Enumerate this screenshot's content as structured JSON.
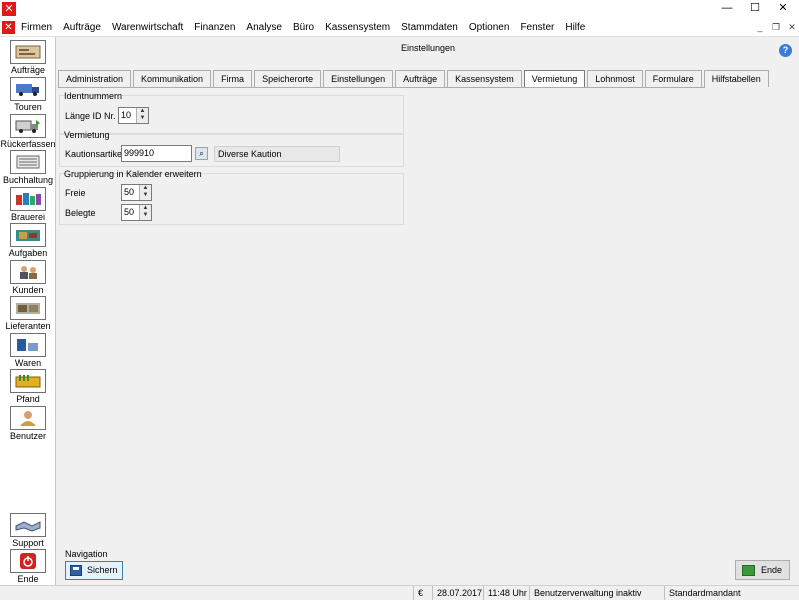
{
  "window": {
    "minimize": "—",
    "maximize": "☐",
    "close": "✕"
  },
  "menu": {
    "items": [
      "Firmen",
      "Aufträge",
      "Warenwirtschaft",
      "Finanzen",
      "Analyse",
      "Büro",
      "Kassensystem",
      "Stammdaten",
      "Optionen",
      "Fenster",
      "Hilfe"
    ],
    "mdi": {
      "minimize": "_",
      "restore": "❐",
      "close": "✕"
    }
  },
  "sidebar": {
    "items": [
      {
        "label": "Aufträge",
        "icon": "orders-icon"
      },
      {
        "label": "Touren",
        "icon": "truck-icon"
      },
      {
        "label": "Rückerfassen",
        "icon": "return-truck-icon"
      },
      {
        "label": "Buchhaltung",
        "icon": "ledger-icon"
      },
      {
        "label": "Brauerei",
        "icon": "brewery-icon"
      },
      {
        "label": "Aufgaben",
        "icon": "tasks-icon"
      },
      {
        "label": "Kunden",
        "icon": "customers-icon"
      },
      {
        "label": "Lieferanten",
        "icon": "suppliers-icon"
      },
      {
        "label": "Waren",
        "icon": "goods-icon"
      },
      {
        "label": "Pfand",
        "icon": "deposit-icon"
      },
      {
        "label": "Benutzer",
        "icon": "user-icon"
      }
    ],
    "support": "Support",
    "end": "Ende"
  },
  "page": {
    "title": "Einstellungen",
    "help": "?"
  },
  "tabs": [
    "Administration",
    "Kommunikation",
    "Firma",
    "Speicherorte",
    "Einstellungen",
    "Aufträge",
    "Kassensystem",
    "Vermietung",
    "Lohnmost",
    "Formulare",
    "Hilfstabellen"
  ],
  "active_tab": "Vermietung",
  "groups": {
    "identnummern": {
      "title": "Identnummern",
      "laenge_label": "Länge ID Nr.",
      "laenge_value": "10"
    },
    "vermietung": {
      "title": "Vermietung",
      "kaution_label": "Kautionsartikel",
      "kaution_value": "999910",
      "kaution_desc": "Diverse Kaution"
    },
    "gruppierung": {
      "title": "Gruppierung in Kalender erweitern",
      "freie_label": "Freie",
      "freie_value": "50",
      "belegte_label": "Belegte",
      "belegte_value": "50"
    }
  },
  "navigation": {
    "label": "Navigation",
    "save": "Sichern",
    "end": "Ende"
  },
  "status": {
    "currency": "€",
    "date": "28.07.2017",
    "time": "11:48 Uhr",
    "user_mgmt": "Benutzerverwaltung inaktiv",
    "client": "Standardmandant"
  },
  "colors": {
    "accent": "#e01818",
    "save_border": "#3c7fb1"
  }
}
